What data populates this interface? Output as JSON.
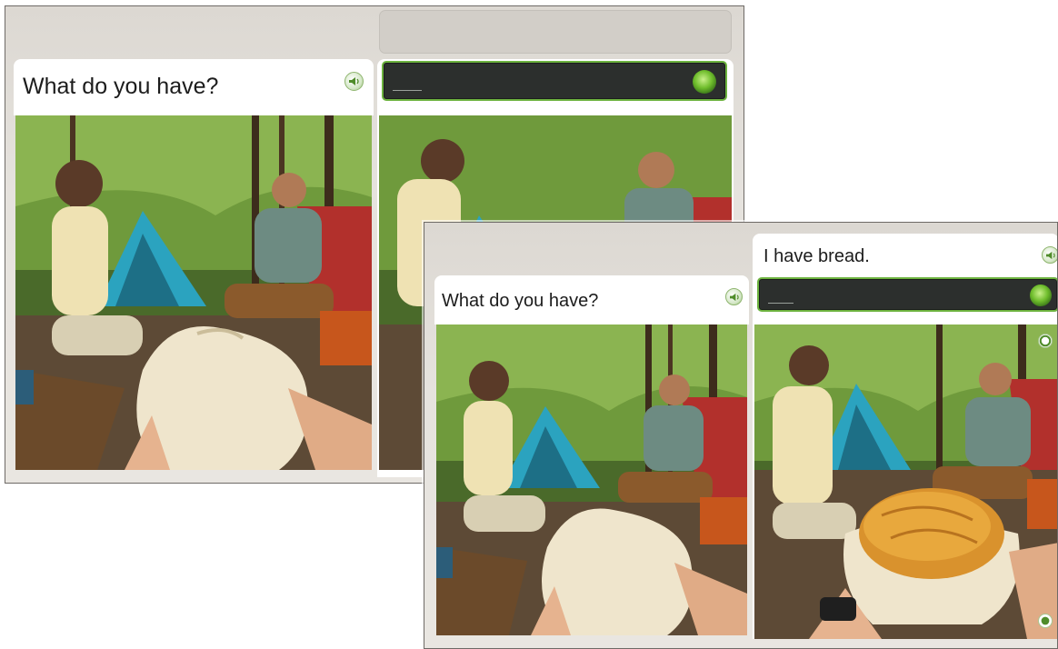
{
  "screens": [
    {
      "prompt": {
        "text": "What do you have?",
        "sound_icon": "speaker-icon"
      },
      "answer": {
        "text": "",
        "mic_icon": "microphone-button-icon"
      }
    },
    {
      "prompt": {
        "text": "What do you have?",
        "sound_icon": "speaker-icon"
      },
      "answer": {
        "text": "I have bread.",
        "mic_icon": "microphone-button-icon"
      }
    }
  ],
  "colors": {
    "accent_green": "#6db33f",
    "mic_bar": "#2c2f2d",
    "background": "#e6e3de"
  }
}
